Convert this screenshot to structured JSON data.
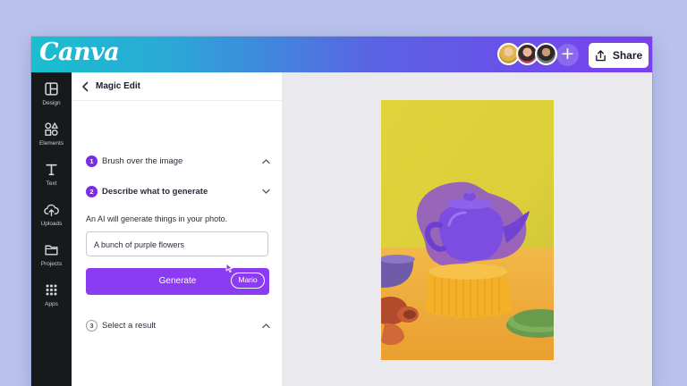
{
  "app": {
    "logo_text": "Canva"
  },
  "topbar": {
    "share_label": "Share",
    "add_collaborator": "+",
    "gradient_colors": [
      "#18bfcf",
      "#5a63e3",
      "#7a3ff0"
    ]
  },
  "sidebar": {
    "items": [
      {
        "label": "Design",
        "icon": "layout-icon"
      },
      {
        "label": "Elements",
        "icon": "shapes-icon"
      },
      {
        "label": "Text",
        "icon": "text-icon"
      },
      {
        "label": "Uploads",
        "icon": "cloud-upload-icon"
      },
      {
        "label": "Projects",
        "icon": "folder-icon"
      },
      {
        "label": "Apps",
        "icon": "apps-grid-icon"
      }
    ]
  },
  "panel": {
    "title": "Magic Edit",
    "steps": [
      {
        "number": "1",
        "label": "Brush over the image"
      },
      {
        "number": "2",
        "label": "Describe what to generate"
      },
      {
        "number": "3",
        "label": "Select a result"
      }
    ],
    "helper_text": "An AI will generate things in your photo.",
    "prompt_value": "A bunch of purple flowers",
    "generate_label": "Generate",
    "cursor_user": "Mario"
  },
  "colors": {
    "accent": "#8b3cf2",
    "sidebar": "#18191b"
  }
}
